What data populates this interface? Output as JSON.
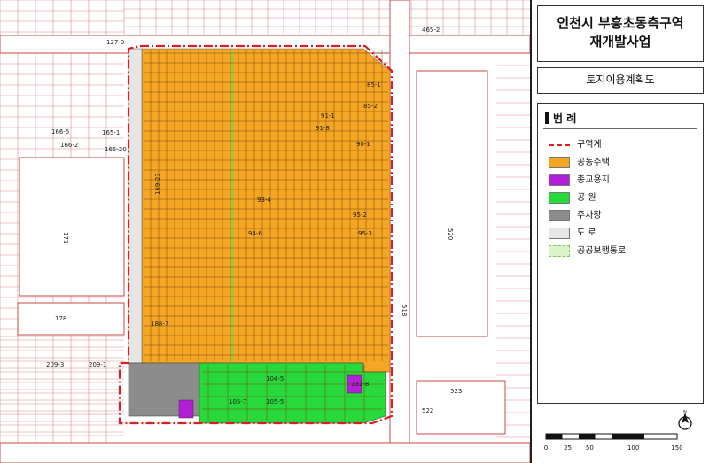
{
  "title": {
    "line1": "인천시 부흥초동측구역",
    "line2": "재개발사업"
  },
  "subtitle": "토지이용계획도",
  "legend": {
    "heading": "범 례",
    "items": [
      {
        "label": "구역계",
        "color": "#d81f26",
        "type": "boundary"
      },
      {
        "label": "공동주택",
        "color": "#f5a623",
        "type": "fill"
      },
      {
        "label": "종교용지",
        "color": "#b21fd6",
        "type": "fill"
      },
      {
        "label": "공 원",
        "color": "#27d93a",
        "type": "fill"
      },
      {
        "label": "주차장",
        "color": "#8c8c8c",
        "type": "fill"
      },
      {
        "label": "도 로",
        "color": "#e6e6e6",
        "type": "fill"
      },
      {
        "label": "공공보행통로",
        "color": "#d9f5c8",
        "type": "dashedfill"
      }
    ]
  },
  "scale_bar": {
    "ticks": [
      "0",
      "25",
      "50",
      "100",
      "150"
    ]
  },
  "north_label": "N",
  "map_labels": {
    "block_north_top": "127-9",
    "block_left_1": "165-1",
    "block_left_2": "166-2",
    "block_left_3": "165-20",
    "block_left_4": "166-5",
    "big_block_left": "171",
    "block_178": "178",
    "block_209_3": "209-3",
    "block_209_1": "209-1",
    "block_520": "520",
    "road_518": "518",
    "block_522": "522",
    "block_523": "523",
    "top_road": "465-2",
    "block_104_5": "104-5",
    "block_105_7": "105-7",
    "block_105_5": "105-5",
    "block_85_1": "85-1",
    "block_85_2": "85-2",
    "block_90_1": "90-1",
    "block_95_2": "95-2",
    "block_95_3": "95-3",
    "block_93_4": "93-4",
    "block_94_6": "94-6",
    "block_91_1": "91-1",
    "block_91_8": "91-8",
    "block_169_23": "169-23",
    "block_188_7": "188-7",
    "block_131_8": "131-8"
  }
}
